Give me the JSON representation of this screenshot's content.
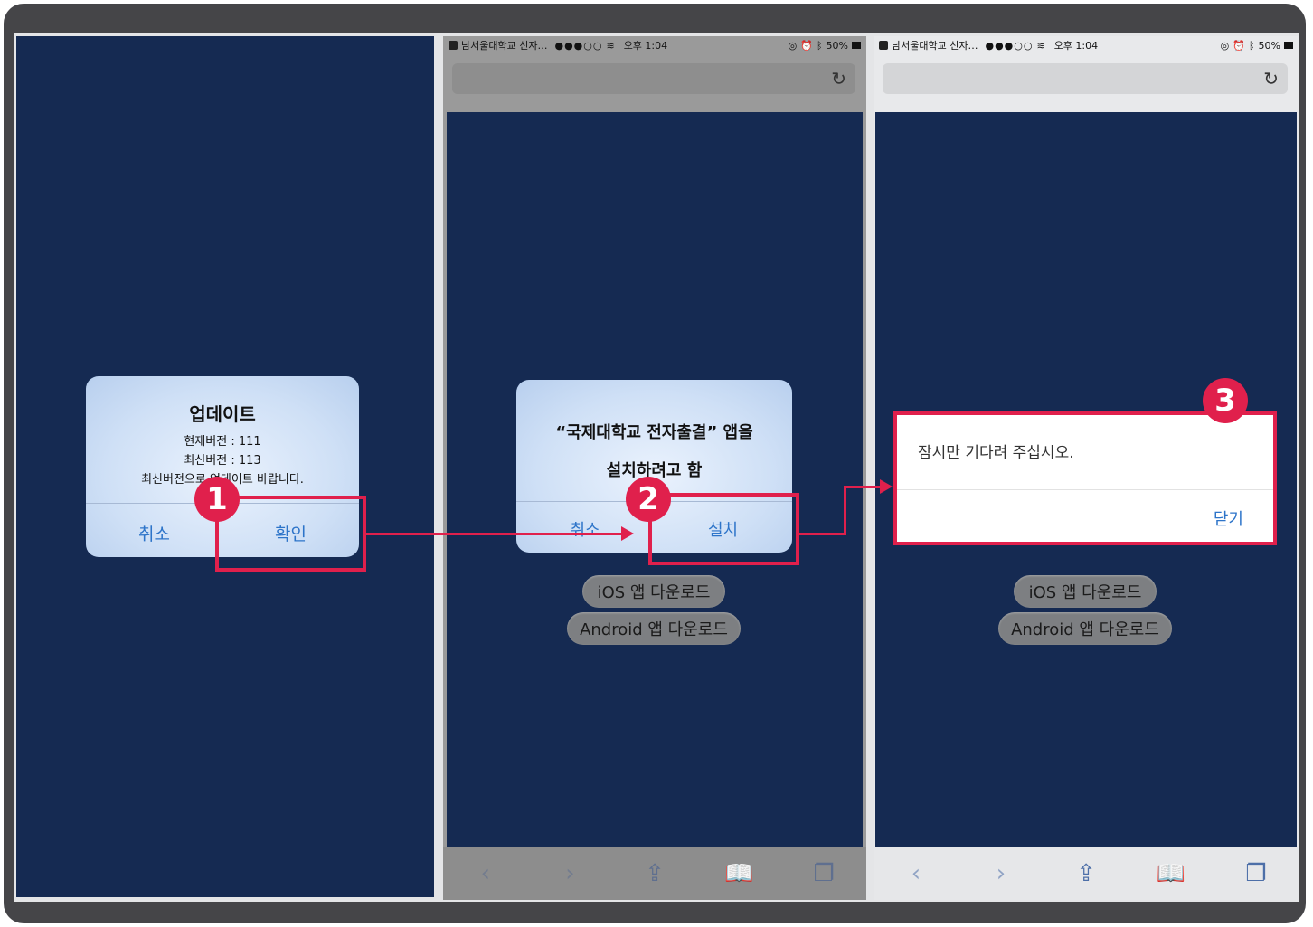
{
  "panel1": {
    "alert": {
      "title": "업데이트",
      "current_version": "현재버전 : 111",
      "latest_version": "최신버전 : 113",
      "message": "최신버전으로 업데이트 바랍니다.",
      "cancel_label": "취소",
      "confirm_label": "확인"
    }
  },
  "panel2": {
    "status": {
      "carrier": "남서울대학교 신자…",
      "signal": "●●●○○",
      "time": "오후 1:04",
      "battery": "50%"
    },
    "reload_icon": "reload-icon",
    "alert": {
      "title": "“국제대학교 전자출결” 앱을",
      "subtitle": "설치하려고 함",
      "cancel_label": "취소",
      "install_label": "설치"
    },
    "buttons": {
      "ios": "iOS 앱 다운로드",
      "android": "Android 앱 다운로드"
    }
  },
  "panel3": {
    "status": {
      "carrier": "남서울대학교 신자…",
      "signal": "●●●○○",
      "time": "오후 1:04",
      "battery": "50%"
    },
    "dialog": {
      "message": "잠시만 기다려 주십시오.",
      "close_label": "닫기"
    },
    "buttons": {
      "ios": "iOS 앱 다운로드",
      "android": "Android 앱 다운로드"
    }
  },
  "steps": [
    "1",
    "2",
    "3"
  ],
  "colors": {
    "highlight": "#e0204c",
    "screen_bg": "#152a52",
    "ios_blue": "#2d74c9"
  },
  "toolbar_icons": [
    "back-icon",
    "forward-icon",
    "share-icon",
    "bookmarks-icon",
    "tabs-icon"
  ]
}
